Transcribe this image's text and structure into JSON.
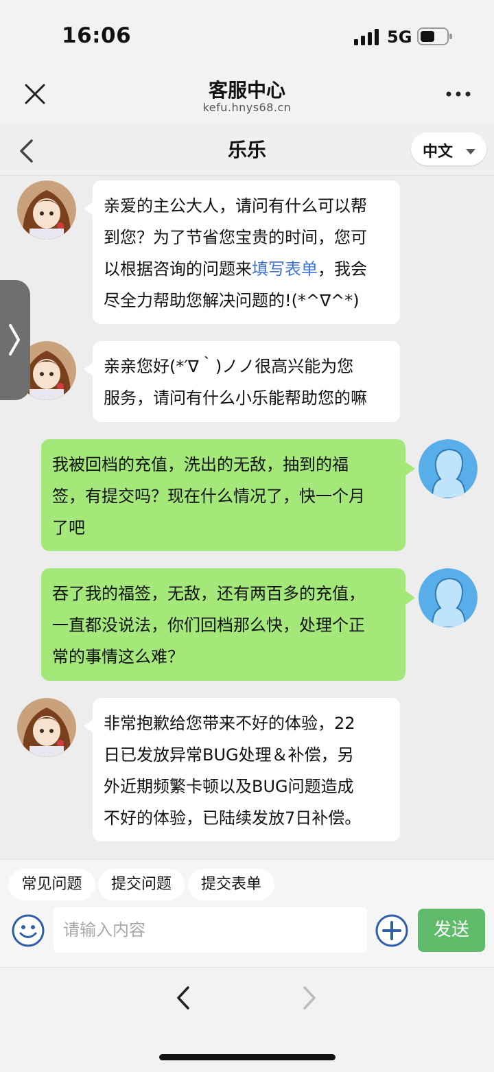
{
  "status_bar": {
    "time": "16:06",
    "network": "5G"
  },
  "webview": {
    "title": "客服中心",
    "domain": "kefu.hnys68.cn"
  },
  "chat": {
    "title": "乐乐",
    "language": "中文"
  },
  "messages": [
    {
      "side": "agent",
      "lines": [
        "亲爱的主公大人，请问有什么可以帮",
        "到您？为了节省您宝贵的时间，您可",
        "以根据咨询的问题来"
      ],
      "link": "填写表单",
      "after_link": "，我会",
      "last_line": "尽全力帮助您解决问题的!(*^∇^*)"
    },
    {
      "side": "agent",
      "lines": [
        "亲亲您好(*′∇｀)ノノ很高兴能为您",
        "服务，请问有什么小乐能帮助您的嘛"
      ]
    },
    {
      "side": "user",
      "lines": [
        "我被回档的充值，洗出的无敌，抽到的福",
        "签，有提交吗？现在什么情况了，快一个月",
        "了吧"
      ]
    },
    {
      "side": "user",
      "lines": [
        "吞了我的福签，无敌，还有两百多的充值，",
        "一直都没说法，你们回档那么快，处理个正",
        "常的事情这么难？"
      ]
    },
    {
      "side": "agent",
      "lines": [
        "非常抱歉给您带来不好的体验，22",
        "日已发放异常BUG处理＆补偿，另",
        "外近期频繁卡顿以及BUG问题造成",
        "不好的体验，已陆续发放7日补偿。"
      ]
    }
  ],
  "quick_actions": [
    "常见问题",
    "提交问题",
    "提交表单"
  ],
  "input": {
    "placeholder": "请输入内容",
    "value": ""
  },
  "send_label": "发送",
  "colors": {
    "user_bubble": "#a5e87a",
    "send_button": "#5fba6a",
    "link": "#3f73d9"
  }
}
